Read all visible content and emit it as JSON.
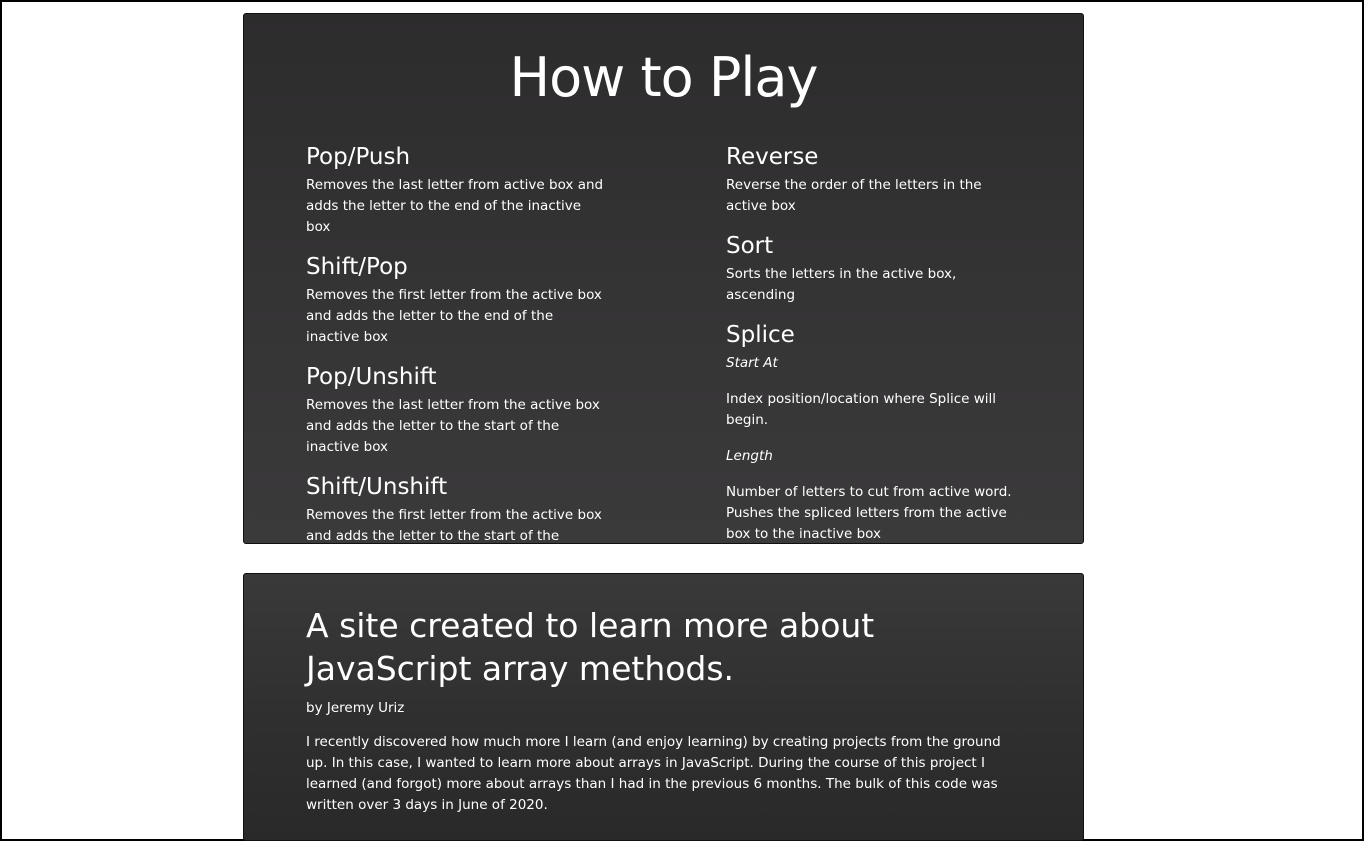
{
  "how_to_play": {
    "title": "How to Play",
    "left_rules": [
      {
        "name": "Pop/Push",
        "desc": "Removes the last letter from active box and adds the letter to the end of the inactive box"
      },
      {
        "name": "Shift/Pop",
        "desc": "Removes the first letter from the active box and adds the letter to the end of the inactive box"
      },
      {
        "name": "Pop/Unshift",
        "desc": "Removes the last letter from the active box and adds the letter to the start of the inactive box"
      },
      {
        "name": "Shift/Unshift",
        "desc": "Removes the first letter from the active box and adds the letter to the start of the inactive box"
      }
    ],
    "right_rules": [
      {
        "name": "Reverse",
        "desc": "Reverse the order of the letters in the active box"
      },
      {
        "name": "Sort",
        "desc": "Sorts the letters in the active box, ascending"
      }
    ],
    "splice": {
      "name": "Splice",
      "start_label": "Start At",
      "start_desc": "Index position/location where Splice will begin.",
      "length_label": "Length",
      "length_desc": "Number of letters to cut from active word. Pushes the spliced letters from the active box to the inactive box"
    }
  },
  "about": {
    "title": "A site created to learn more about JavaScript array methods.",
    "author": "by Jeremy Uriz",
    "body": "I recently discovered how much more I learn (and enjoy learning) by creating projects from the ground up. In this case, I wanted to learn more about arrays in JavaScript. During the course of this project I learned (and forgot) more about arrays than I had in the previous 6 months. The bulk of this code was written over 3 days in June of 2020."
  }
}
